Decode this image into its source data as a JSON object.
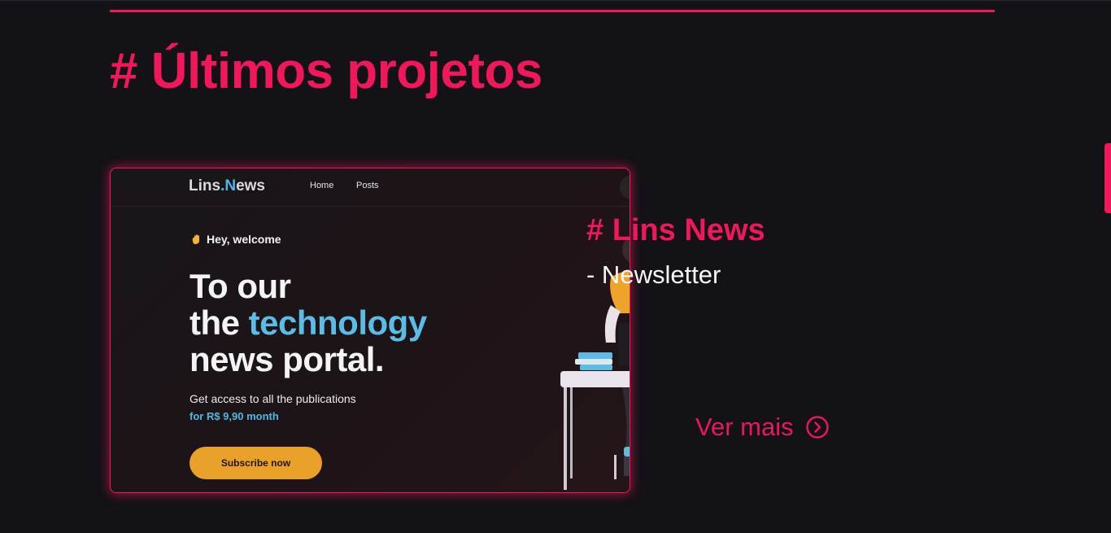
{
  "section": {
    "title": "# Últimos projetos"
  },
  "project": {
    "name": "# Lins News",
    "type": "- Newsletter",
    "cta_label": "Ver mais",
    "cta_icon": "chevron-right-circle-icon"
  },
  "preview": {
    "logo_prefix": "Lins",
    "logo_dot": ".",
    "logo_suffix": "News",
    "nav": [
      "Home",
      "Posts"
    ],
    "greeting": "Hey, welcome",
    "greeting_icon": "waving-hand-icon",
    "hero_line1": "To our",
    "hero_line2_a": "the ",
    "hero_line2_b": "technology",
    "hero_line3": "news portal.",
    "description": "Get access to all the publications",
    "price": "for R$ 9,90 month",
    "button_label": "Subscribe now"
  },
  "colors": {
    "background": "#131217",
    "accent": "#f0185a",
    "preview_blue": "#4fb8e6",
    "preview_button": "#e9a12a"
  }
}
